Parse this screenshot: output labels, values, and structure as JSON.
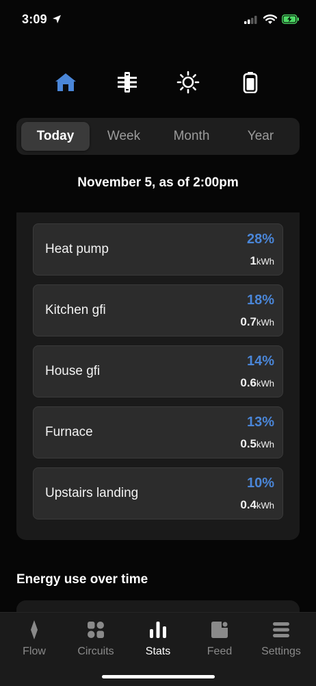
{
  "status_bar": {
    "time": "3:09"
  },
  "categories": [
    {
      "icon": "home-icon",
      "active": true
    },
    {
      "icon": "panel-icon",
      "active": false
    },
    {
      "icon": "sun-icon",
      "active": false
    },
    {
      "icon": "battery-icon",
      "active": false
    }
  ],
  "periods": [
    "Today",
    "Week",
    "Month",
    "Year"
  ],
  "selected_period": "Today",
  "date_heading": "November 5, as of 2:00pm",
  "circuits": [
    {
      "name": "Heat pump",
      "percent": "28%",
      "energy": "1",
      "unit": "kWh"
    },
    {
      "name": "Kitchen gfi",
      "percent": "18%",
      "energy": "0.7",
      "unit": "kWh"
    },
    {
      "name": "House gfi",
      "percent": "14%",
      "energy": "0.6",
      "unit": "kWh"
    },
    {
      "name": "Furnace",
      "percent": "13%",
      "energy": "0.5",
      "unit": "kWh"
    },
    {
      "name": "Upstairs landing",
      "percent": "10%",
      "energy": "0.4",
      "unit": "kWh"
    }
  ],
  "section_title": "Energy use over time",
  "tabs": [
    {
      "label": "Flow",
      "icon": "flow-icon",
      "active": false
    },
    {
      "label": "Circuits",
      "icon": "circuits-icon",
      "active": false
    },
    {
      "label": "Stats",
      "icon": "stats-icon",
      "active": true
    },
    {
      "label": "Feed",
      "icon": "feed-icon",
      "active": false
    },
    {
      "label": "Settings",
      "icon": "settings-icon",
      "active": false
    }
  ],
  "colors": {
    "accent": "#4a86d8",
    "background": "#060606",
    "card": "#2c2c2c",
    "battery_green": "#4cd964"
  }
}
